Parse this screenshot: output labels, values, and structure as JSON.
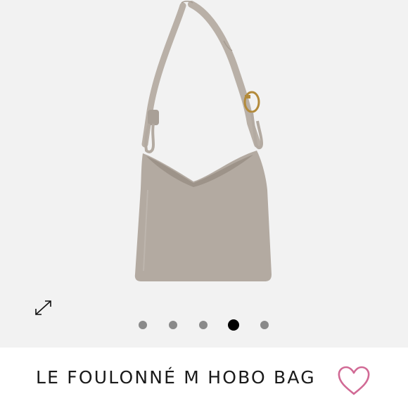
{
  "product": {
    "name": "LE FOULONNÉ M HOBO BAG",
    "image_icon": "hobo-bag-product-photo"
  },
  "gallery": {
    "expand_icon": "expand-arrows-icon",
    "slide_count": 5,
    "active_slide": 4
  },
  "actions": {
    "wishlist_icon": "heart-outline-icon"
  },
  "colors": {
    "gallery_background": "#f2f2f2",
    "bag_taupe": "#b3aaa1",
    "buckle_gold": "#b38a3a",
    "wishlist_pink": "#d16a95",
    "dot_inactive": "#8a8a8a",
    "dot_active": "#000000"
  }
}
